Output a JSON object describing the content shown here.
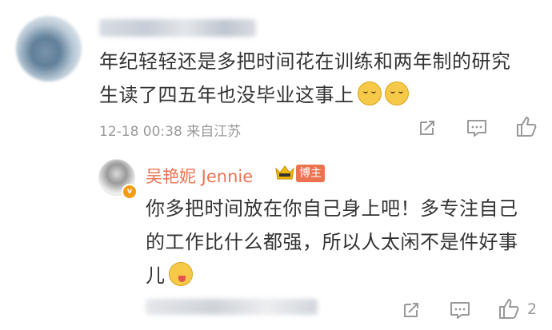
{
  "comment": {
    "text": "年纪轻轻还是多把时间花在训练和两年制的研究生读了四五年也没毕业这事上",
    "emoji_icons": [
      "cry-laugh-icon",
      "cry-laugh-icon"
    ],
    "timestamp": "12-18 00:38",
    "location": "来自江苏"
  },
  "reply": {
    "name": "吴艳妮 Jennie",
    "badge": "博主",
    "vbadge": "v",
    "text": "你多把时间放在你自己身上吧！多专注自己的工作比什么都强，所以人太闲不是件好事儿",
    "emoji_icon": "tongue-out-icon",
    "like_count": "2"
  },
  "colors": {
    "accent": "#eb7350",
    "meta": "#999999",
    "text": "#333333"
  }
}
